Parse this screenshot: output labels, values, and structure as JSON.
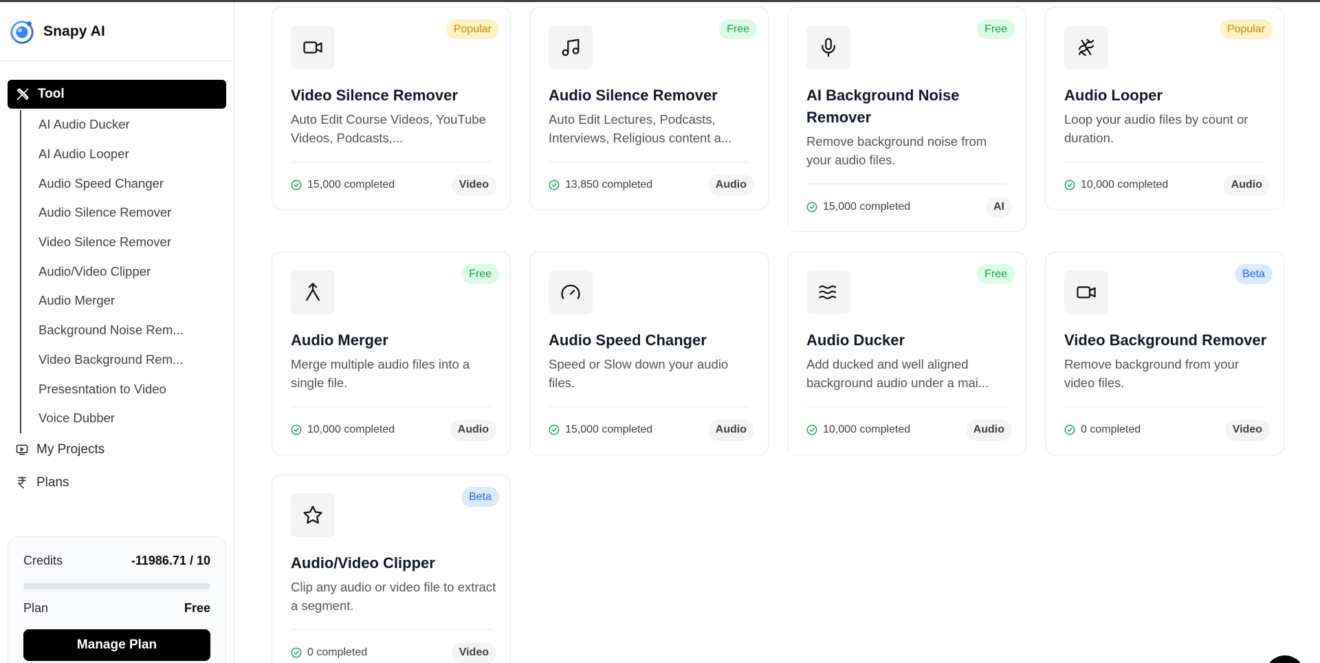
{
  "app": {
    "name": "Snapy AI"
  },
  "sidebar": {
    "tool_label": "Tool",
    "sub_items": [
      "AI Audio Ducker",
      "AI Audio Looper",
      "Audio Speed Changer",
      "Audio Silence Remover",
      "Video Silence Remover",
      "Audio/Video Clipper",
      "Audio Merger",
      "Background Noise Rem...",
      "Video Background Rem...",
      "Presesntation to Video",
      "Voice Dubber"
    ],
    "my_projects": "My Projects",
    "plans": "Plans",
    "credits_label": "Credits",
    "credits_value": "-11986.71 / 10",
    "credits_progress": 0,
    "plan_label": "Plan",
    "plan_value": "Free",
    "manage_plan": "Manage Plan"
  },
  "cards": [
    {
      "title": "Video Silence Remover",
      "desc": "Auto Edit Course Videos, YouTube Videos, Podcasts,...",
      "badge": "Popular",
      "badge_type": "popular",
      "completed": "15,000 completed",
      "category": "Video",
      "icon": "video-camera-icon"
    },
    {
      "title": "Audio Silence Remover",
      "desc": "Auto Edit Lectures, Podcasts, Interviews, Religious content a...",
      "badge": "Free",
      "badge_type": "free",
      "completed": "13,850 completed",
      "category": "Audio",
      "icon": "music-note-icon"
    },
    {
      "title": "AI Background Noise Remover",
      "desc": "Remove background noise from your audio files.",
      "badge": "Free",
      "badge_type": "free",
      "completed": "15,000 completed",
      "category": "AI",
      "icon": "microphone-icon"
    },
    {
      "title": "Audio Looper",
      "desc": "Loop your audio files by count or duration.",
      "badge": "Popular",
      "badge_type": "popular",
      "completed": "10,000 completed",
      "category": "Audio",
      "icon": "loop-icon"
    },
    {
      "title": "Audio Merger",
      "desc": "Merge multiple audio files into a single file.",
      "badge": "Free",
      "badge_type": "free",
      "completed": "10,000 completed",
      "category": "Audio",
      "icon": "merge-icon"
    },
    {
      "title": "Audio Speed Changer",
      "desc": "Speed or Slow down your audio files.",
      "badge": "",
      "badge_type": "",
      "completed": "15,000 completed",
      "category": "Audio",
      "icon": "gauge-icon"
    },
    {
      "title": "Audio Ducker",
      "desc": "Add ducked and well aligned background audio under a mai...",
      "badge": "Free",
      "badge_type": "free",
      "completed": "10,000 completed",
      "category": "Audio",
      "icon": "waves-icon"
    },
    {
      "title": "Video Background Remover",
      "desc": "Remove background from your video files.",
      "badge": "Beta",
      "badge_type": "beta",
      "completed": "0 completed",
      "category": "Video",
      "icon": "video-camera-icon"
    },
    {
      "title": "Audio/Video Clipper",
      "desc": "Clip any audio or video file to extract a segment.",
      "badge": "Beta",
      "badge_type": "beta",
      "completed": "0 completed",
      "category": "Video",
      "icon": "star-icon"
    }
  ]
}
